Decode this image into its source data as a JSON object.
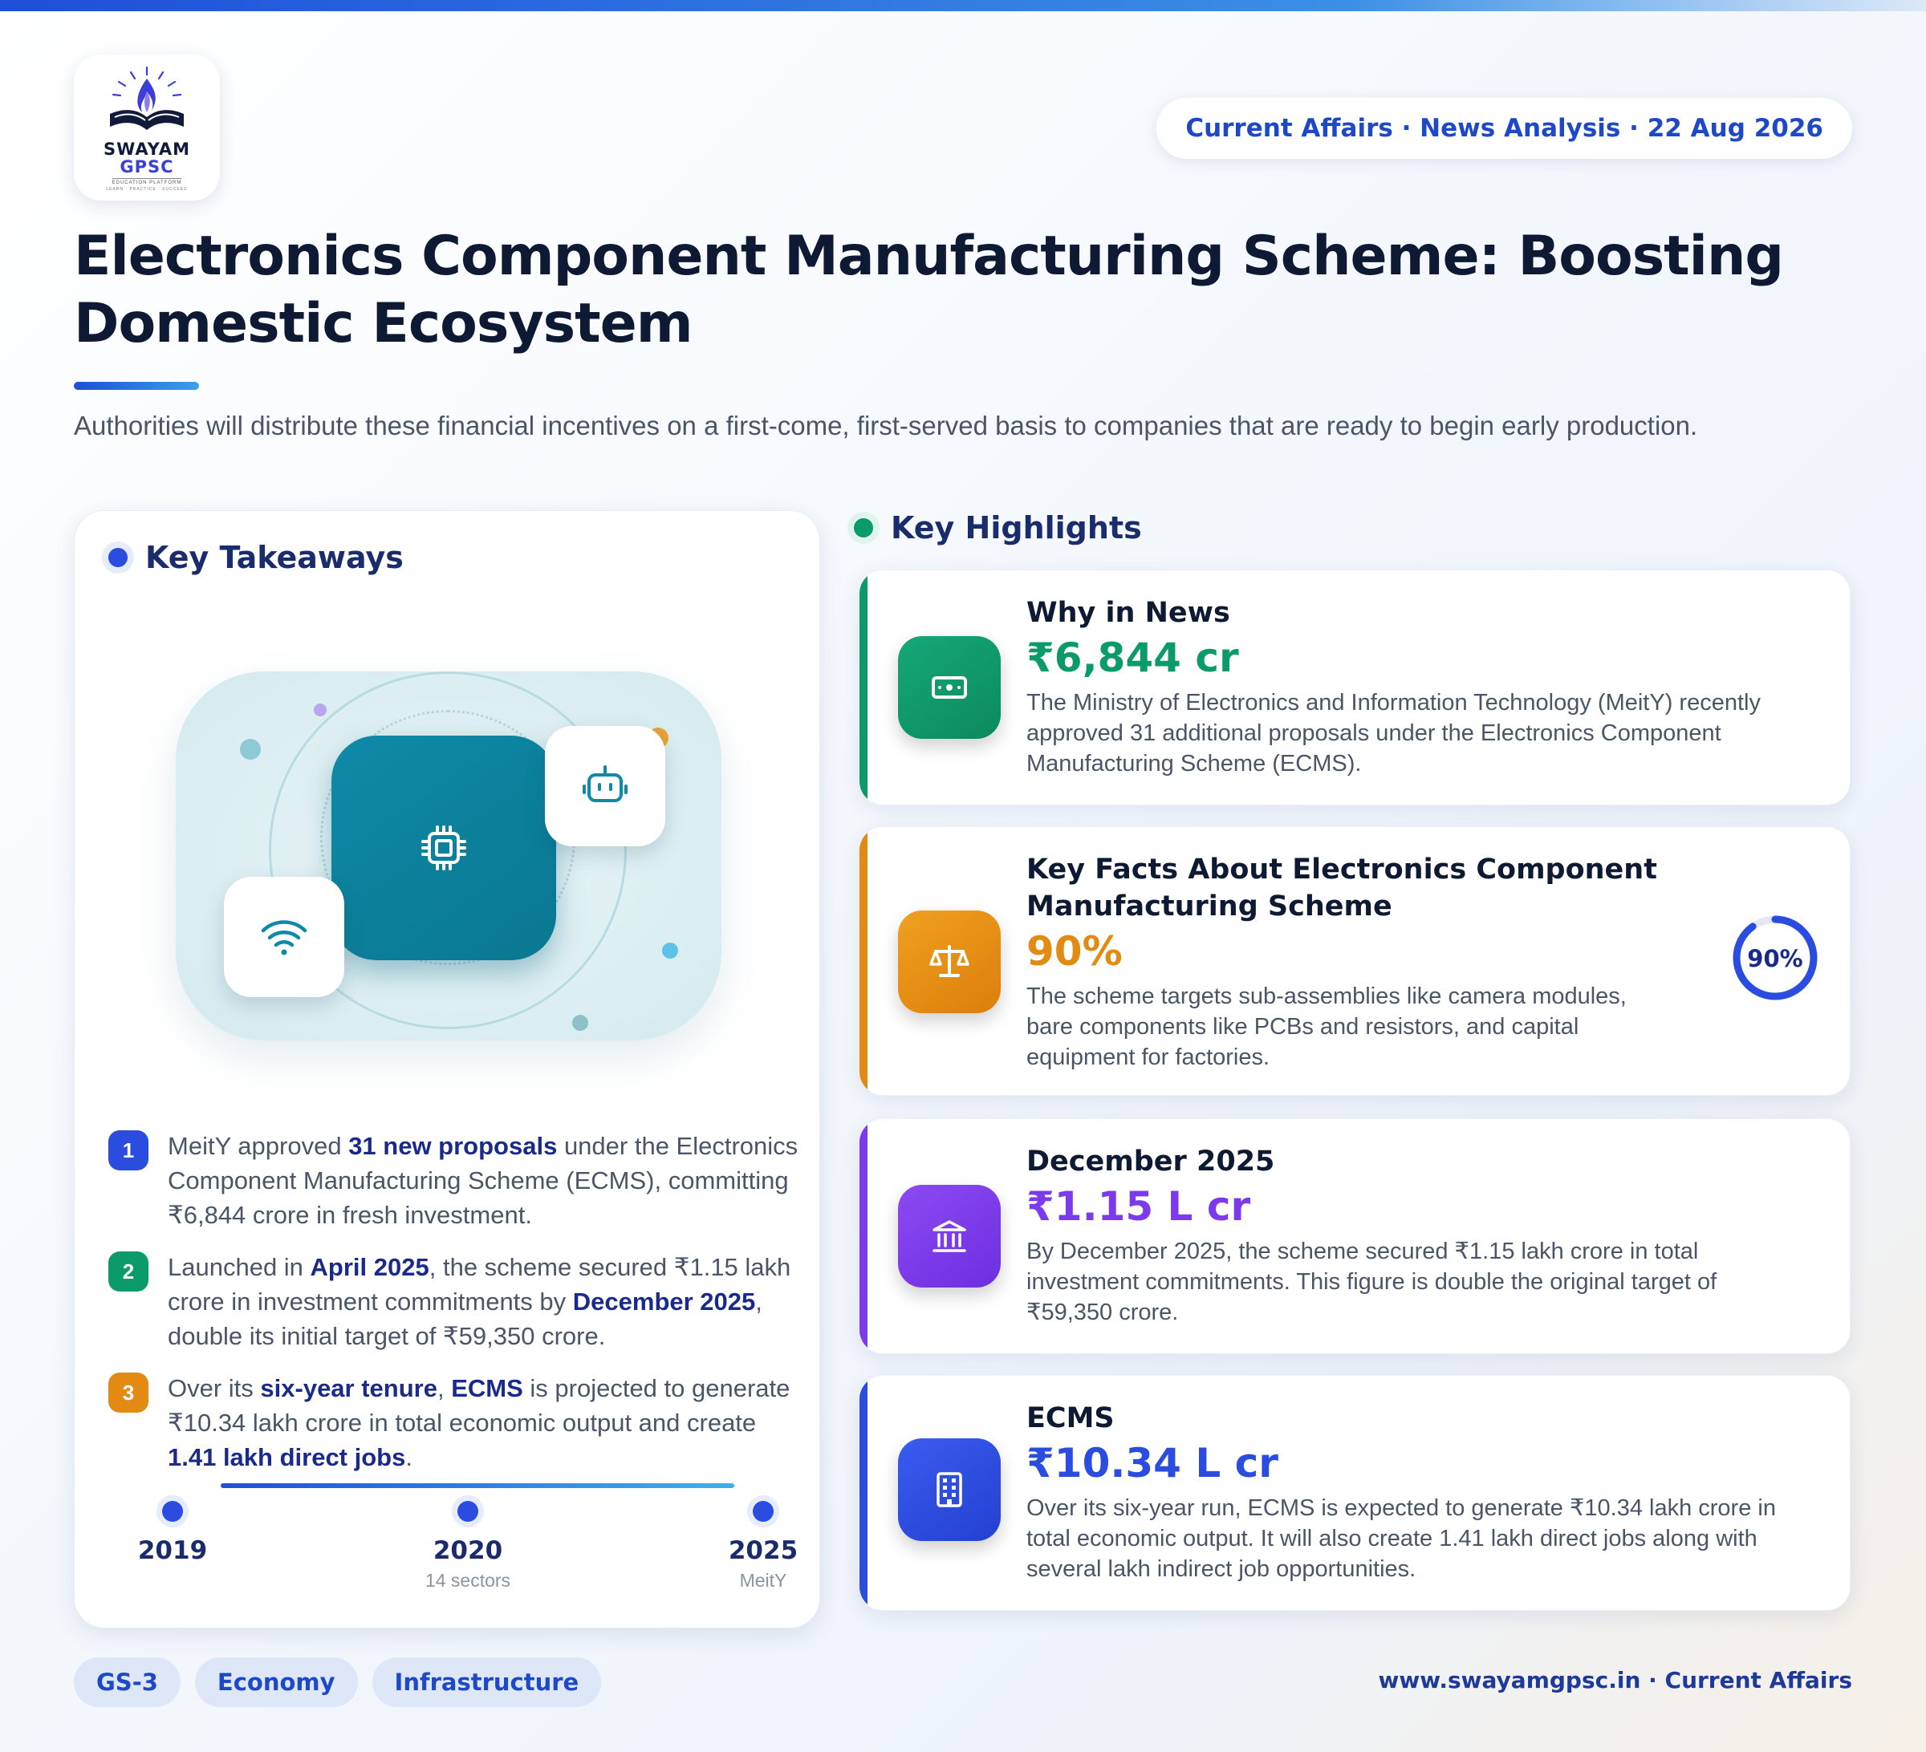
{
  "brand": {
    "line1": "SWAYAM",
    "line2": "GPSC",
    "line3": "EDUCATION PLATFORM",
    "line4": "LEARN · PRACTICE · SUCCEED"
  },
  "header": {
    "date_pill": "Current Affairs · News Analysis · 22 Aug 2026"
  },
  "title": "Electronics Component Manufacturing Scheme: Boosting Domestic Ecosystem",
  "subtitle": "Authorities will distribute these financial incentives on a first-come, first-served basis to companies that are ready to begin early production.",
  "left": {
    "heading": "Key Takeaways",
    "takeaways": [
      {
        "num": "1",
        "parts": [
          {
            "t": "MeitY approved ",
            "b": false
          },
          {
            "t": "31 new proposals",
            "b": true
          },
          {
            "t": " under the Electronics Component Manufacturing Scheme (ECMS), committing ₹6,844 crore in fresh investment.",
            "b": false
          }
        ]
      },
      {
        "num": "2",
        "parts": [
          {
            "t": "Launched in ",
            "b": false
          },
          {
            "t": "April 2025",
            "b": true
          },
          {
            "t": ", the scheme secured ₹1.15 lakh crore in investment commitments by ",
            "b": false
          },
          {
            "t": "December 2025",
            "b": true
          },
          {
            "t": ", double its initial target of ₹59,350 crore.",
            "b": false
          }
        ]
      },
      {
        "num": "3",
        "parts": [
          {
            "t": "Over its ",
            "b": false
          },
          {
            "t": "six-year tenure",
            "b": true
          },
          {
            "t": ", ",
            "b": false
          },
          {
            "t": "ECMS",
            "b": true
          },
          {
            "t": " is projected to generate ₹10.34 lakh crore in total economic output and create ",
            "b": false
          },
          {
            "t": "1.41 lakh direct jobs",
            "b": true
          },
          {
            "t": ".",
            "b": false
          }
        ]
      }
    ],
    "timeline": [
      {
        "year": "2019",
        "sub": ""
      },
      {
        "year": "2020",
        "sub": "14 sectors"
      },
      {
        "year": "2025",
        "sub": "MeitY"
      }
    ],
    "illustration_icons": [
      "chip-icon",
      "robot-icon",
      "wifi-icon"
    ]
  },
  "highlights": {
    "heading": "Key Highlights",
    "cards": [
      {
        "title": "Why in News",
        "value": "₹6,844 cr",
        "color": "#0b9a6a",
        "icon": "money-icon",
        "desc": "The Ministry of Electronics and Information Technology (MeitY) recently approved 31 additional proposals under the Electronics Component Manufacturing Scheme (ECMS)."
      },
      {
        "title": "Key Facts About Electronics Component Manufacturing Scheme",
        "value": "90%",
        "color": "#e38a12",
        "icon": "scale-icon",
        "desc": "The scheme targets sub-assemblies like camera modules, bare components like PCBs and resistors, and capital equipment for factories.",
        "gauge_label": "90%",
        "gauge_fraction": 0.9
      },
      {
        "title": "December 2025",
        "value": "₹1.15 L cr",
        "color": "#7c3aed",
        "icon": "bank-icon",
        "desc": "By December 2025, the scheme secured ₹1.15 lakh crore in total investment commitments. This figure is double the original target of ₹59,350 crore."
      },
      {
        "title": "ECMS",
        "value": "₹10.34 L cr",
        "color": "#2a4de0",
        "icon": "building-icon",
        "desc": "Over its six-year run, ECMS is expected to generate ₹10.34 lakh crore in total economic output. It will also create 1.41 lakh direct jobs along with several lakh indirect job opportunities."
      }
    ]
  },
  "tags": [
    "GS-3",
    "Economy",
    "Infrastructure"
  ],
  "footer": "www.swayamgpsc.in · Current Affairs"
}
